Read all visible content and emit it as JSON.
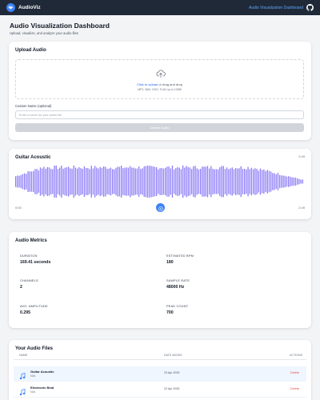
{
  "app": {
    "brand": "AudioViz",
    "nav_link": "Audio Visualization Dashboard",
    "accent": "#3b82f6"
  },
  "page": {
    "title": "Audio Visualization Dashboard",
    "subtitle": "Upload, visualize, and analyze your audio files"
  },
  "upload": {
    "title": "Upload Audio",
    "link_text": "Click to upload",
    "drop_text": "or drag and drop",
    "hint": "MP3, WAV, OGG, FLAC up to 10MB",
    "name_label": "Custom Name (optional)",
    "name_placeholder": "Enter a name for your audio file",
    "button": "Upload Audio"
  },
  "player": {
    "track": "Guitar Acoustic",
    "duration_top": "2:49",
    "current": "0:00",
    "duration": "2:49",
    "waveform_color": "#8b7cf6"
  },
  "metrics": {
    "title": "Audio Metrics",
    "items": [
      {
        "label": "DURATION",
        "value": "169.41 seconds"
      },
      {
        "label": "ESTIMATED BPM",
        "value": "180"
      },
      {
        "label": "CHANNELS",
        "value": "2"
      },
      {
        "label": "SAMPLE RATE",
        "value": "48000 Hz"
      },
      {
        "label": "AVG. AMPLITUDE",
        "value": "0.295"
      },
      {
        "label": "PEAK COUNT",
        "value": "700"
      }
    ]
  },
  "files": {
    "title": "Your Audio Files",
    "columns": [
      "NAME",
      "DATE ADDED",
      "ACTIONS"
    ],
    "rows": [
      {
        "name": "Guitar Acoustic",
        "sub": "N/A",
        "date": "23 Apr 2025",
        "action": "Delete"
      },
      {
        "name": "Electronic Beat",
        "sub": "N/A",
        "date": "22 Apr 2025",
        "action": "Delete"
      }
    ]
  }
}
